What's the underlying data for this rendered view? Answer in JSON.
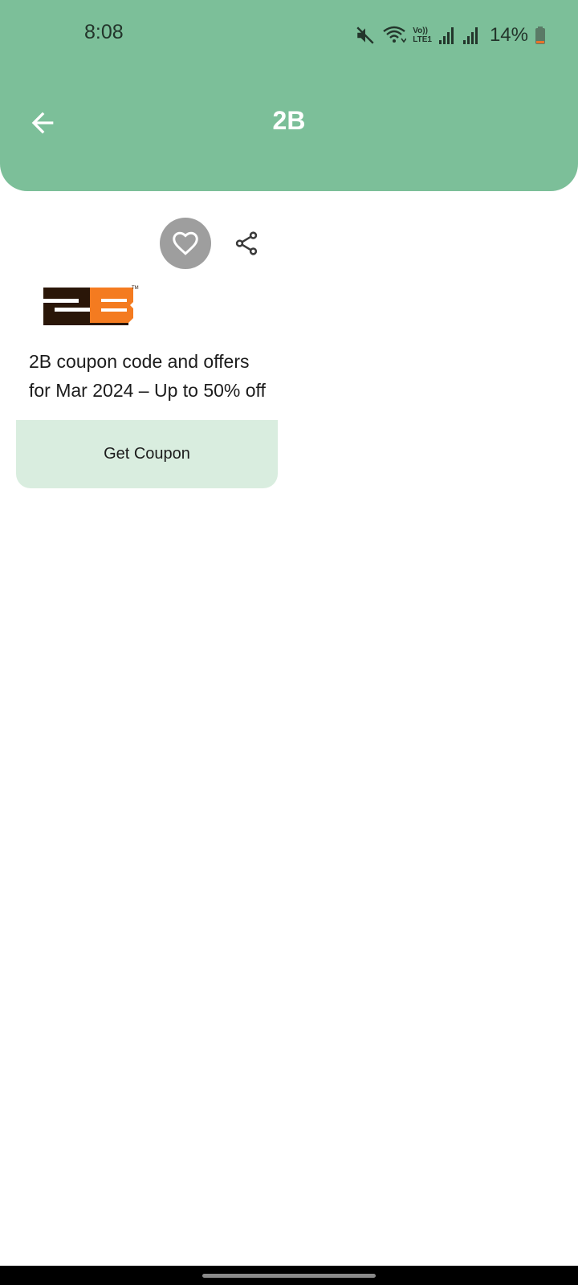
{
  "status_bar": {
    "time": "8:08",
    "battery": "14%",
    "icons": [
      "mute-icon",
      "wifi-icon",
      "volte-icon",
      "signal-icon",
      "signal-icon",
      "battery-icon"
    ],
    "volte_text_top": "Vo))",
    "volte_text_bottom": "LTE1"
  },
  "toolbar": {
    "title": "2B",
    "back_icon": "arrow-back-icon"
  },
  "card": {
    "favorite_icon": "heart-icon",
    "share_icon": "share-icon",
    "logo_text": "2B",
    "logo_tm": "TM",
    "title": "2B coupon code and offers for Mar 2024 – Up to 50% off",
    "button_label": "Get Coupon"
  },
  "colors": {
    "header": "#7cbf99",
    "coupon_button": "#d9eddf",
    "favorite_circle": "#9e9e9e",
    "logo_orange": "#f47b20",
    "logo_dark": "#2a1608"
  }
}
